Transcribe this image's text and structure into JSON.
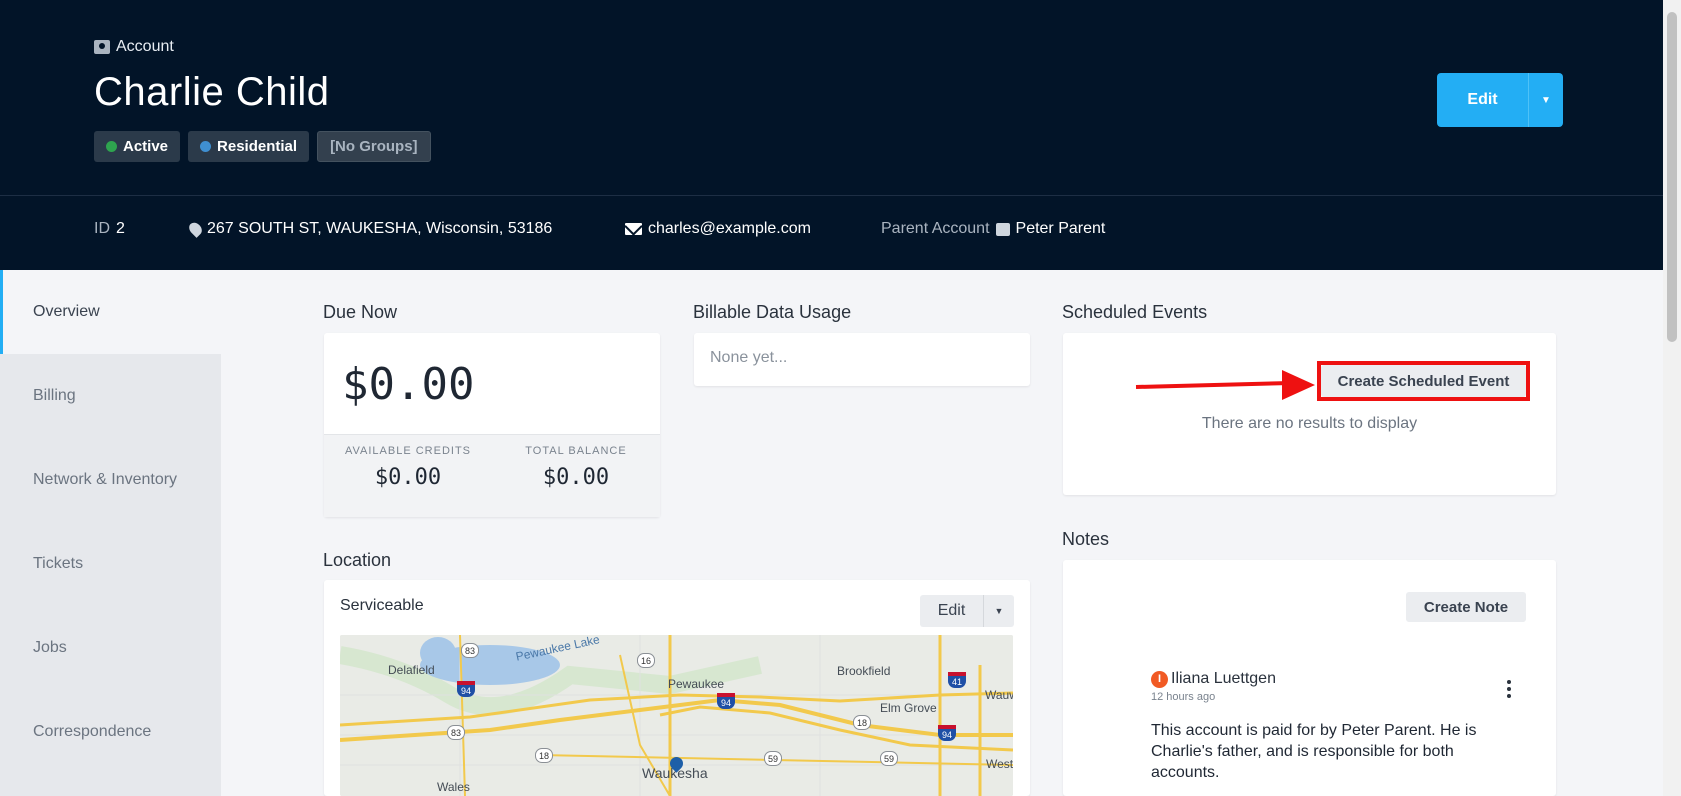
{
  "header": {
    "crumb": "Account",
    "name": "Charlie Child",
    "badges": {
      "active": "Active",
      "residential": "Residential",
      "groups": "[No Groups]"
    },
    "edit_label": "Edit",
    "colors": {
      "active": "#2ea44f",
      "residential": "#3f8fd1",
      "edit": "#23aef4"
    }
  },
  "meta": {
    "id_label": "ID",
    "id_value": "2",
    "address": "267 SOUTH ST, WAUKESHA, Wisconsin, 53186",
    "email": "charles@example.com",
    "parent_label": "Parent Account",
    "parent_value": "Peter Parent"
  },
  "sidebar": {
    "items": [
      {
        "label": "Overview",
        "active": true
      },
      {
        "label": "Billing"
      },
      {
        "label": "Network & Inventory"
      },
      {
        "label": "Tickets"
      },
      {
        "label": "Jobs"
      },
      {
        "label": "Correspondence"
      }
    ]
  },
  "due": {
    "title": "Due Now",
    "amount": "$0.00",
    "credits_label": "AVAILABLE CREDITS",
    "credits_value": "$0.00",
    "balance_label": "TOTAL BALANCE",
    "balance_value": "$0.00"
  },
  "usage": {
    "title": "Billable Data Usage",
    "placeholder": "None yet..."
  },
  "events": {
    "title": "Scheduled Events",
    "create_label": "Create Scheduled Event",
    "empty": "There are no results to display"
  },
  "notes": {
    "title": "Notes",
    "create_label": "Create Note",
    "author": "Iliana Luettgen",
    "author_initial": "I",
    "time": "12 hours ago",
    "body_line1": "This account is paid for by Peter Parent. He is",
    "body_line2": "Charlie's father, and is responsible for both",
    "body_line3": "accounts."
  },
  "location": {
    "title": "Location",
    "status": "Serviceable",
    "edit_label": "Edit",
    "map": {
      "places": [
        "Delafield",
        "Pewaukee Lake",
        "Pewaukee",
        "Brookfield",
        "Elm Grove",
        "Wauwatosa",
        "Waukesha",
        "Wales",
        "West Allis"
      ],
      "shields": [
        "83",
        "16",
        "83",
        "18",
        "18",
        "59",
        "59"
      ],
      "interstates": [
        "94",
        "94",
        "41",
        "94"
      ]
    }
  }
}
